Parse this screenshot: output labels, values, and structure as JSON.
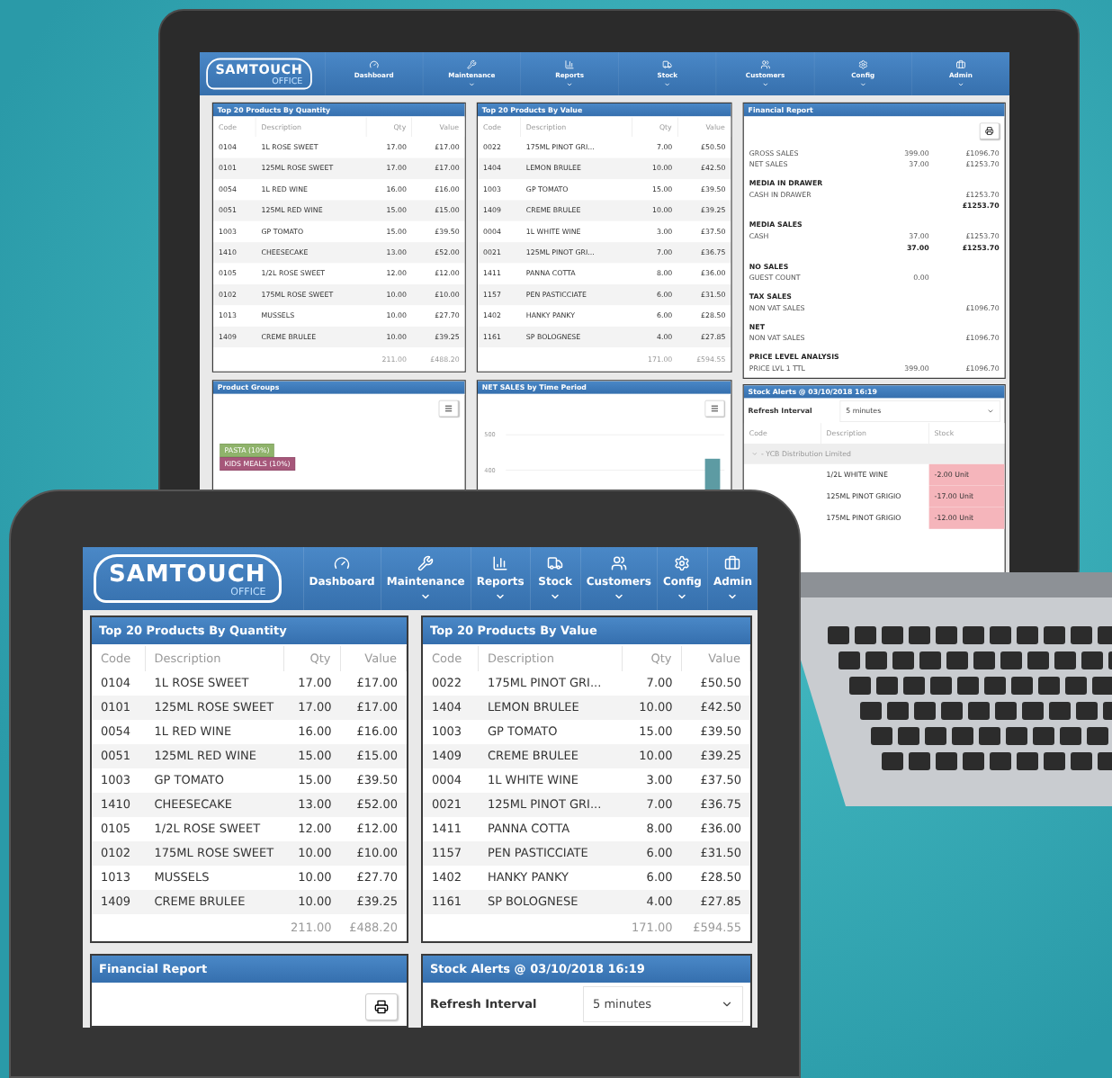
{
  "laptop": {
    "logo": {
      "name": "SAMTOUCH",
      "tagline": "OFFICE"
    },
    "nav": [
      {
        "label": "Dashboard",
        "dropdown": false
      },
      {
        "label": "Maintenance",
        "dropdown": true
      },
      {
        "label": "Reports",
        "dropdown": true
      },
      {
        "label": "Stock",
        "dropdown": true
      },
      {
        "label": "Customers",
        "dropdown": true
      },
      {
        "label": "Config",
        "dropdown": true
      },
      {
        "label": "Admin",
        "dropdown": true
      }
    ],
    "quantity_table": {
      "title": "Top 20 Products By Quantity",
      "columns": [
        "Code",
        "Description",
        "Qty",
        "Value"
      ],
      "rows": [
        [
          "0104",
          "1L ROSE SWEET",
          "17.00",
          "£17.00"
        ],
        [
          "0101",
          "125ML ROSE SWEET",
          "17.00",
          "£17.00"
        ],
        [
          "0054",
          "1L RED WINE",
          "16.00",
          "£16.00"
        ],
        [
          "0051",
          "125ML RED WINE",
          "15.00",
          "£15.00"
        ],
        [
          "1003",
          "GP TOMATO",
          "15.00",
          "£39.50"
        ],
        [
          "1410",
          "CHEESECAKE",
          "13.00",
          "£52.00"
        ],
        [
          "0105",
          "1/2L ROSE SWEET",
          "12.00",
          "£12.00"
        ],
        [
          "0102",
          "175ML ROSE SWEET",
          "10.00",
          "£10.00"
        ],
        [
          "1013",
          "MUSSELS",
          "10.00",
          "£27.70"
        ],
        [
          "1409",
          "CREME BRULEE",
          "10.00",
          "£39.25"
        ]
      ],
      "totals": [
        "211.00",
        "£488.20"
      ]
    },
    "value_table": {
      "title": "Top 20 Products By Value",
      "columns": [
        "Code",
        "Description",
        "Qty",
        "Value"
      ],
      "rows": [
        [
          "0022",
          "175ML PINOT GRI...",
          "7.00",
          "£50.50"
        ],
        [
          "1404",
          "LEMON BRULEE",
          "10.00",
          "£42.50"
        ],
        [
          "1003",
          "GP TOMATO",
          "15.00",
          "£39.50"
        ],
        [
          "1409",
          "CREME BRULEE",
          "10.00",
          "£39.25"
        ],
        [
          "0004",
          "1L WHITE WINE",
          "3.00",
          "£37.50"
        ],
        [
          "0021",
          "125ML PINOT GRI...",
          "7.00",
          "£36.75"
        ],
        [
          "1411",
          "PANNA COTTA",
          "8.00",
          "£36.00"
        ],
        [
          "1157",
          "PEN PASTICCIATE",
          "6.00",
          "£31.50"
        ],
        [
          "1402",
          "HANKY PANKY",
          "6.00",
          "£28.50"
        ],
        [
          "1161",
          "SP BOLOGNESE",
          "4.00",
          "£27.85"
        ]
      ],
      "totals": [
        "171.00",
        "£594.55"
      ]
    },
    "financial_report": {
      "title": "Financial Report",
      "lines": [
        {
          "kind": "line",
          "label": "GROSS SALES",
          "amount": "399.00",
          "total": "£1096.70"
        },
        {
          "kind": "line",
          "label": "NET SALES",
          "amount": "37.00",
          "total": "£1253.70"
        },
        {
          "kind": "heading",
          "label": "MEDIA IN DRAWER"
        },
        {
          "kind": "line",
          "label": "CASH IN DRAWER",
          "total": "£1253.70"
        },
        {
          "kind": "subtotal",
          "total": "£1253.70"
        },
        {
          "kind": "heading",
          "label": "MEDIA SALES"
        },
        {
          "kind": "line",
          "label": "CASH",
          "amount": "37.00",
          "total": "£1253.70"
        },
        {
          "kind": "subtotal",
          "amount": "37.00",
          "total": "£1253.70"
        },
        {
          "kind": "heading",
          "label": "NO SALES"
        },
        {
          "kind": "line",
          "label": "GUEST COUNT",
          "amount": "0.00"
        },
        {
          "kind": "heading",
          "label": "TAX SALES"
        },
        {
          "kind": "line",
          "label": "NON VAT SALES",
          "total": "£1096.70"
        },
        {
          "kind": "heading",
          "label": "NET"
        },
        {
          "kind": "line",
          "label": "NON VAT SALES",
          "total": "£1096.70"
        },
        {
          "kind": "heading",
          "label": "PRICE LEVEL ANALYSIS"
        },
        {
          "kind": "line",
          "label": "PRICE LVL 1 TTL",
          "amount": "399.00",
          "total": "£1096.70"
        }
      ]
    },
    "product_groups": {
      "title": "Product Groups",
      "labels": [
        {
          "text": "PASTA (10%)",
          "color": "#8fb36b"
        },
        {
          "text": "KIDS MEALS (10%)",
          "color": "#a6577a"
        }
      ]
    },
    "net_sales": {
      "title": "NET SALES by Time Period",
      "axis_labels": [
        "500",
        "400"
      ]
    },
    "stock_alerts": {
      "title": "Stock Alerts @ 03/10/2018 16:19",
      "refresh_label": "Refresh Interval",
      "refresh_value": "5 minutes",
      "columns": [
        "Code",
        "Description",
        "Stock"
      ],
      "group": "- YCB Distribution Limited",
      "rows": [
        {
          "description": "1/2L WHITE WINE",
          "stock": "-2.00 Unit"
        },
        {
          "description": "125ML PINOT GRIGIO",
          "stock": "-17.00 Unit"
        },
        {
          "description": "175ML PINOT GRIGIO",
          "stock": "-12.00 Unit"
        }
      ]
    }
  },
  "tablet": {
    "logo": {
      "name": "SAMTOUCH",
      "tagline": "OFFICE"
    },
    "nav": [
      {
        "label": "Dashboard",
        "dropdown": false
      },
      {
        "label": "Maintenance",
        "dropdown": true
      },
      {
        "label": "Reports",
        "dropdown": true
      },
      {
        "label": "Stock",
        "dropdown": true
      },
      {
        "label": "Customers",
        "dropdown": true
      },
      {
        "label": "Config",
        "dropdown": true
      },
      {
        "label": "Admin",
        "dropdown": true
      }
    ],
    "quantity_table": {
      "title": "Top 20 Products By Quantity",
      "columns": [
        "Code",
        "Description",
        "Qty",
        "Value"
      ],
      "rows": [
        [
          "0104",
          "1L ROSE SWEET",
          "17.00",
          "£17.00"
        ],
        [
          "0101",
          "125ML ROSE SWEET",
          "17.00",
          "£17.00"
        ],
        [
          "0054",
          "1L RED WINE",
          "16.00",
          "£16.00"
        ],
        [
          "0051",
          "125ML RED WINE",
          "15.00",
          "£15.00"
        ],
        [
          "1003",
          "GP TOMATO",
          "15.00",
          "£39.50"
        ],
        [
          "1410",
          "CHEESECAKE",
          "13.00",
          "£52.00"
        ],
        [
          "0105",
          "1/2L ROSE SWEET",
          "12.00",
          "£12.00"
        ],
        [
          "0102",
          "175ML ROSE SWEET",
          "10.00",
          "£10.00"
        ],
        [
          "1013",
          "MUSSELS",
          "10.00",
          "£27.70"
        ],
        [
          "1409",
          "CREME BRULEE",
          "10.00",
          "£39.25"
        ]
      ],
      "totals": [
        "211.00",
        "£488.20"
      ]
    },
    "value_table": {
      "title": "Top 20 Products By Value",
      "columns": [
        "Code",
        "Description",
        "Qty",
        "Value"
      ],
      "rows": [
        [
          "0022",
          "175ML PINOT GRI...",
          "7.00",
          "£50.50"
        ],
        [
          "1404",
          "LEMON BRULEE",
          "10.00",
          "£42.50"
        ],
        [
          "1003",
          "GP TOMATO",
          "15.00",
          "£39.50"
        ],
        [
          "1409",
          "CREME BRULEE",
          "10.00",
          "£39.25"
        ],
        [
          "0004",
          "1L WHITE WINE",
          "3.00",
          "£37.50"
        ],
        [
          "0021",
          "125ML PINOT GRI...",
          "7.00",
          "£36.75"
        ],
        [
          "1411",
          "PANNA COTTA",
          "8.00",
          "£36.00"
        ],
        [
          "1157",
          "PEN PASTICCIATE",
          "6.00",
          "£31.50"
        ],
        [
          "1402",
          "HANKY PANKY",
          "6.00",
          "£28.50"
        ],
        [
          "1161",
          "SP BOLOGNESE",
          "4.00",
          "£27.85"
        ]
      ],
      "totals": [
        "171.00",
        "£594.55"
      ]
    },
    "financial_report": {
      "title": "Financial Report"
    },
    "stock_alerts": {
      "title": "Stock Alerts @ 03/10/2018 16:19",
      "refresh_label": "Refresh Interval",
      "refresh_value": "5 minutes"
    }
  }
}
